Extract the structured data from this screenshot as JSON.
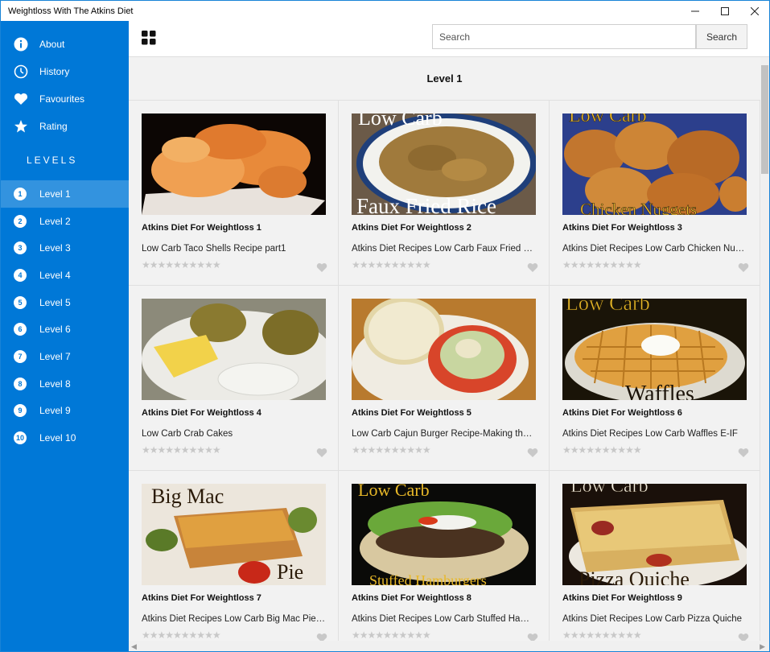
{
  "window": {
    "title": "Weightloss With The Atkins Diet",
    "minimize_glyph": "—",
    "maximize_glyph": "☐",
    "close_glyph": "✕"
  },
  "sidebar": {
    "items": [
      {
        "label": "About",
        "icon": "info-icon"
      },
      {
        "label": "History",
        "icon": "clock-icon"
      },
      {
        "label": "Favourites",
        "icon": "heart-icon"
      },
      {
        "label": "Rating",
        "icon": "star-icon"
      }
    ],
    "levels_heading": "LEVELS",
    "levels": [
      {
        "num": "1",
        "label": "Level 1",
        "active": true
      },
      {
        "num": "2",
        "label": "Level 2"
      },
      {
        "num": "3",
        "label": "Level 3"
      },
      {
        "num": "4",
        "label": "Level 4"
      },
      {
        "num": "5",
        "label": "Level 5"
      },
      {
        "num": "6",
        "label": "Level 6"
      },
      {
        "num": "7",
        "label": "Level 7"
      },
      {
        "num": "8",
        "label": "Level 8"
      },
      {
        "num": "9",
        "label": "Level 9"
      },
      {
        "num": "10",
        "label": "Level 10"
      }
    ]
  },
  "topbar": {
    "search_placeholder": "Search",
    "search_button": "Search"
  },
  "main": {
    "heading": "Level 1",
    "stars": "★★★★★★★★★★",
    "cards": [
      {
        "title": "Atkins Diet For Weightloss 1",
        "subtitle": "Low Carb Taco Shells Recipe part1",
        "overlay_top": "",
        "overlay_bottom": ""
      },
      {
        "title": "Atkins Diet For Weightloss 2",
        "subtitle": "Atkins Diet Recipes Low Carb Faux Fried Rice",
        "overlay_top": "Low Carb",
        "overlay_bottom": "Faux Fried Rice"
      },
      {
        "title": "Atkins Diet For Weightloss 3",
        "subtitle": "Atkins Diet Recipes Low Carb Chicken Nuggets",
        "overlay_top": "Low Carb",
        "overlay_bottom": "Chicken Nuggets"
      },
      {
        "title": "Atkins Diet For Weightloss 4",
        "subtitle": "Low Carb Crab Cakes",
        "overlay_top": "",
        "overlay_bottom": ""
      },
      {
        "title": "Atkins Diet For Weightloss 5",
        "subtitle": "Low Carb Cajun Burger Recipe-Making the Burger",
        "overlay_top": "",
        "overlay_bottom": ""
      },
      {
        "title": "Atkins Diet For Weightloss 6",
        "subtitle": "Atkins Diet Recipes Low Carb Waffles E-IF",
        "overlay_top": "Low Carb",
        "overlay_bottom": "Waffles"
      },
      {
        "title": "Atkins Diet For Weightloss 7",
        "subtitle": "Atkins Diet Recipes Low Carb Big Mac Pie IF",
        "overlay_top": "Big Mac",
        "overlay_bottom": "Pie"
      },
      {
        "title": "Atkins Diet For Weightloss 8",
        "subtitle": "Atkins Diet Recipes Low Carb Stuffed Hamburgers",
        "overlay_top": "Low Carb",
        "overlay_bottom": "Stuffed Hamburgers"
      },
      {
        "title": "Atkins Diet For Weightloss 9",
        "subtitle": "Atkins Diet Recipes Low Carb Pizza Quiche",
        "overlay_top": "Low Carb",
        "overlay_bottom": "Pizza Quiche"
      }
    ]
  },
  "colors": {
    "accent": "#0078d7",
    "active_level": "#3393df",
    "content_bg": "#f2f2f2"
  }
}
